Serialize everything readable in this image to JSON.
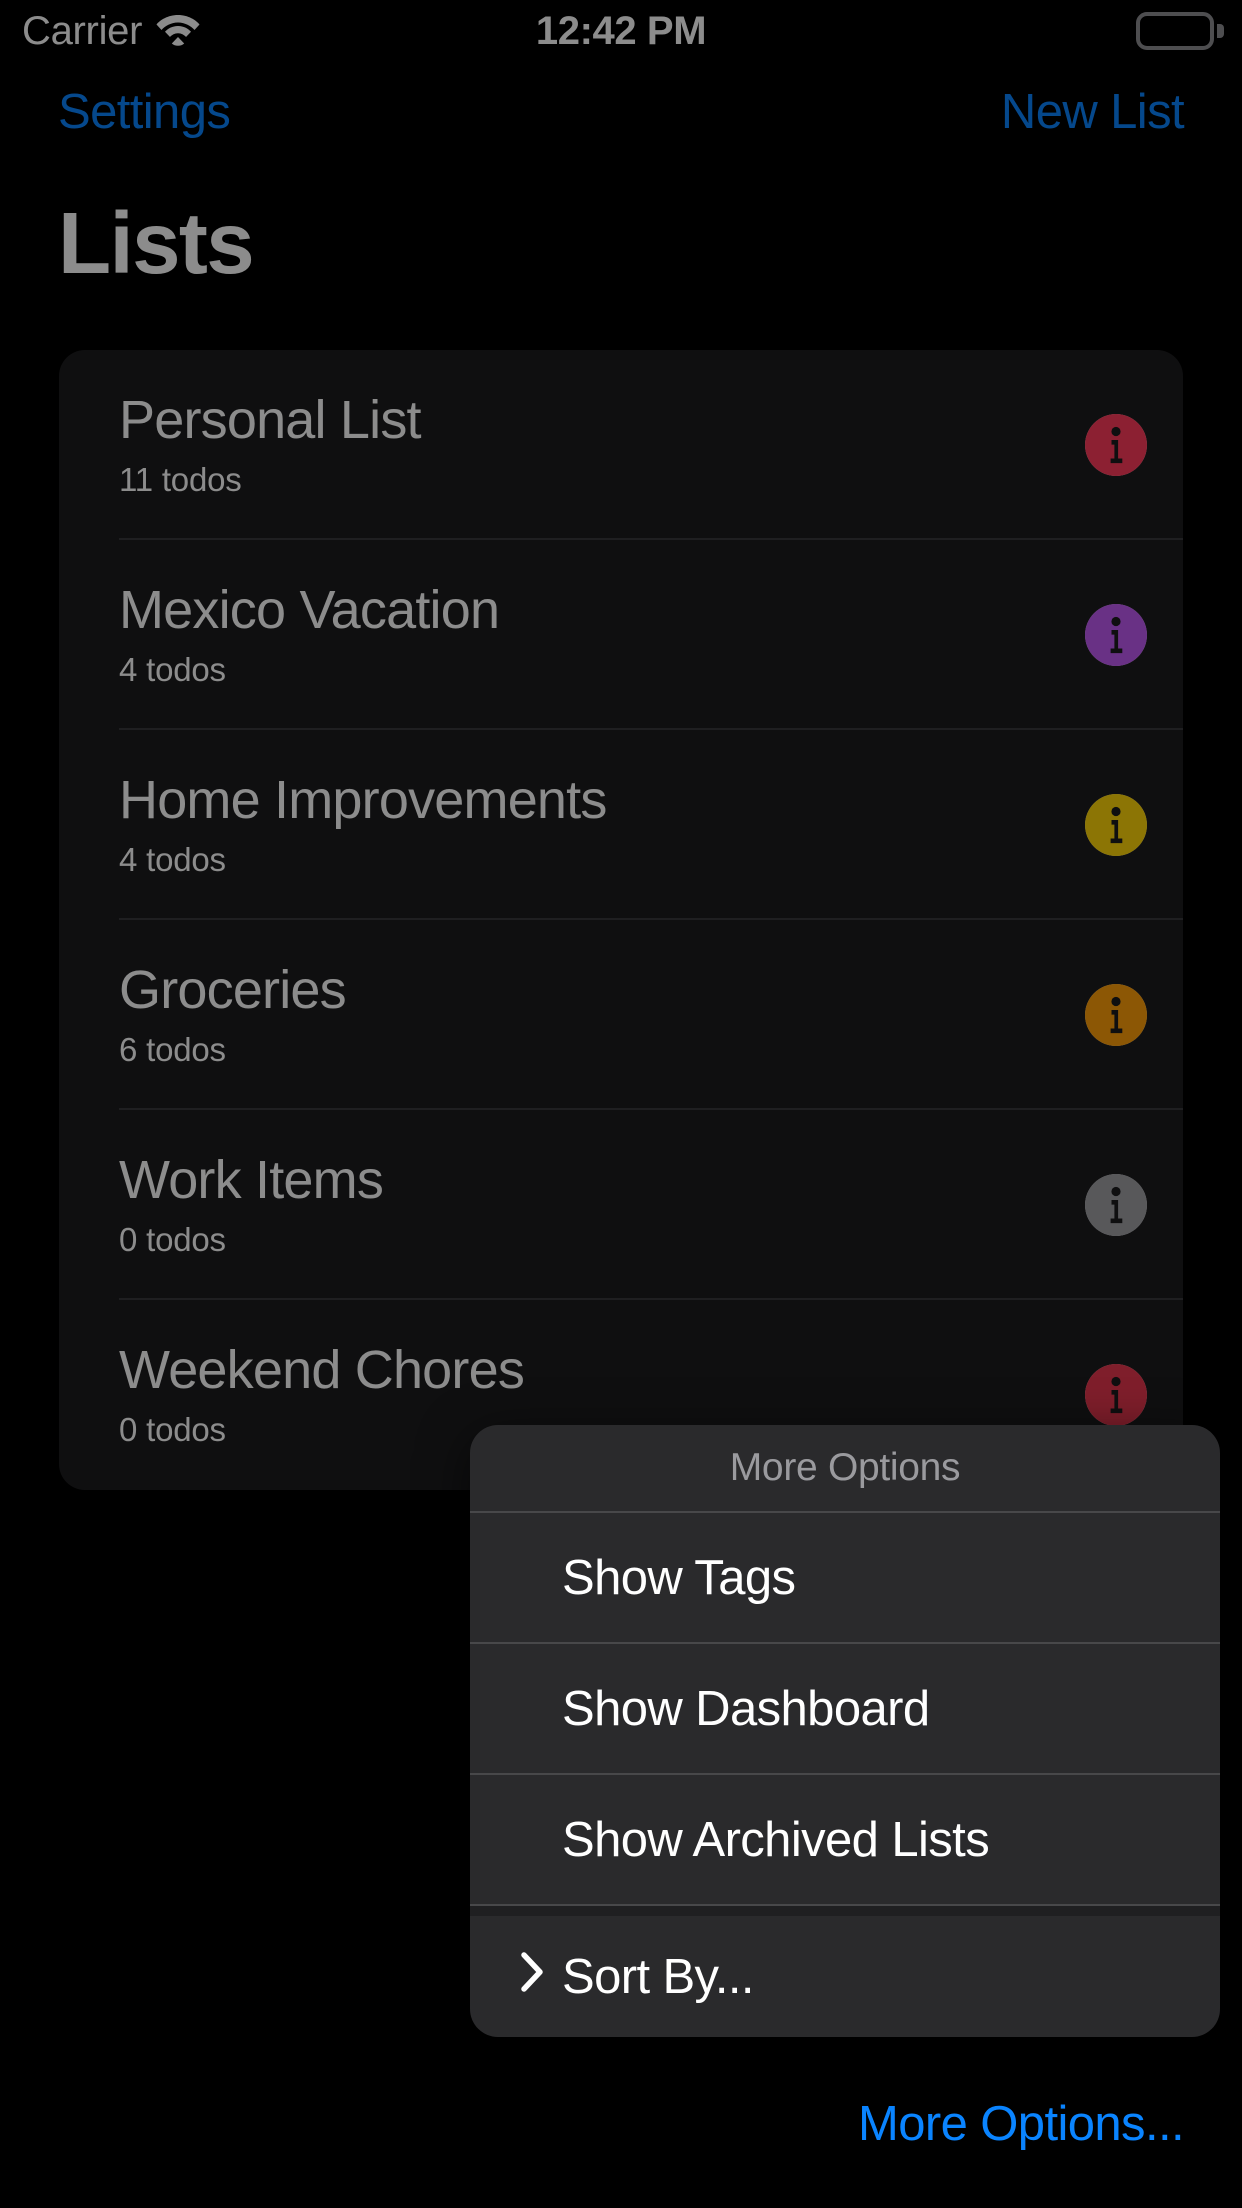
{
  "statusbar": {
    "carrier": "Carrier",
    "time": "12:42 PM",
    "wifi_icon": "wifi-icon",
    "battery_icon": "battery-full-icon"
  },
  "navbar": {
    "left_label": "Settings",
    "right_label": "New List",
    "accent_color": "#0A84FF"
  },
  "page": {
    "title": "Lists"
  },
  "lists": [
    {
      "title": "Personal List",
      "subtitle": "11 todos",
      "info_color": "#FF3B5C",
      "icon": "info-circle-icon"
    },
    {
      "title": "Mexico Vacation",
      "subtitle": "4 todos",
      "info_color": "#BF5AF2",
      "icon": "info-circle-icon"
    },
    {
      "title": "Home Improvements",
      "subtitle": "4 todos",
      "info_color": "#FFD60A",
      "icon": "info-circle-icon"
    },
    {
      "title": "Groceries",
      "subtitle": "6 todos",
      "info_color": "#FF9F0A",
      "icon": "info-circle-icon"
    },
    {
      "title": "Work Items",
      "subtitle": "0 todos",
      "info_color": "#A0A0A5",
      "icon": "info-circle-icon"
    },
    {
      "title": "Weekend Chores",
      "subtitle": "0 todos",
      "info_color": "#E8374F",
      "icon": "info-circle-icon"
    }
  ],
  "popup": {
    "header": "More Options",
    "items": [
      {
        "label": "Show Tags",
        "icon": null
      },
      {
        "label": "Show Dashboard",
        "icon": null
      },
      {
        "label": "Show Archived Lists",
        "icon": null
      },
      {
        "label": "Sort By...",
        "icon": "chevron-right-icon"
      }
    ]
  },
  "bottom": {
    "more_options_label": "More Options..."
  }
}
